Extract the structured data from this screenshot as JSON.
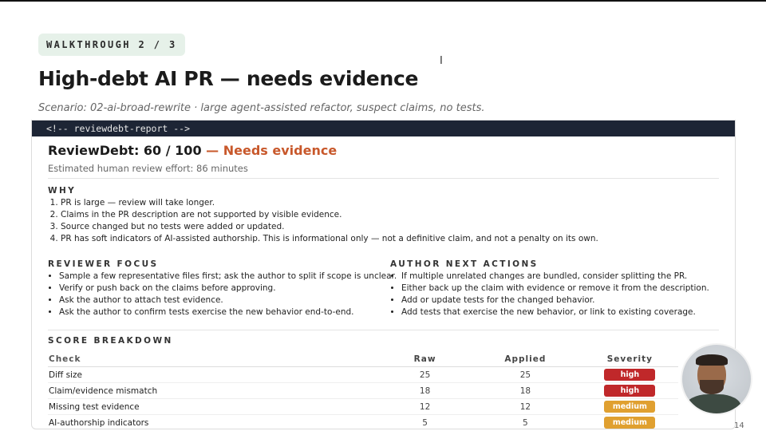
{
  "header": {
    "eyebrow": "WALKTHROUGH 2 / 3",
    "title": "High-debt AI PR — needs evidence",
    "scenario": "Scenario: 02-ai-broad-rewrite · large agent-assisted refactor, suspect claims, no tests."
  },
  "report": {
    "comment": "<!-- reviewdebt-report -->",
    "score_label": "ReviewDebt: 60 / 100",
    "verdict": "— Needs evidence",
    "effort": "Estimated human review effort: 86 minutes",
    "why_title": "WHY",
    "why": [
      "PR is large — review will take longer.",
      "Claims in the PR description are not supported by visible evidence.",
      "Source changed but no tests were added or updated.",
      "PR has soft indicators of AI-assisted authorship. This is informational only — not a definitive claim, and not a penalty on its own."
    ],
    "reviewer_title": "REVIEWER FOCUS",
    "reviewer": [
      "Sample a few representative files first; ask the author to split if scope is unclear.",
      "Verify or push back on the claims before approving.",
      "Ask the author to attach test evidence.",
      "Ask the author to confirm tests exercise the new behavior end-to-end."
    ],
    "author_title": "AUTHOR NEXT ACTIONS",
    "author": [
      "If multiple unrelated changes are bundled, consider splitting the PR.",
      "Either back up the claim with evidence or remove it from the description.",
      "Add or update tests for the changed behavior.",
      "Add tests that exercise the new behavior, or link to existing coverage."
    ],
    "breakdown_title": "SCORE BREAKDOWN",
    "columns": {
      "check": "Check",
      "raw": "Raw",
      "applied": "Applied",
      "severity": "Severity"
    },
    "rows": [
      {
        "check": "Diff size",
        "raw": "25",
        "applied": "25",
        "severity": "high"
      },
      {
        "check": "Claim/evidence mismatch",
        "raw": "18",
        "applied": "18",
        "severity": "high"
      },
      {
        "check": "Missing test evidence",
        "raw": "12",
        "applied": "12",
        "severity": "medium"
      },
      {
        "check": "AI-authorship indicators",
        "raw": "5",
        "applied": "5",
        "severity": "medium"
      }
    ]
  },
  "colors": {
    "high": "#c0282a",
    "medium": "#e0a030",
    "verdict": "#c8582b",
    "codebar": "#1d2535"
  },
  "page_number": "14"
}
